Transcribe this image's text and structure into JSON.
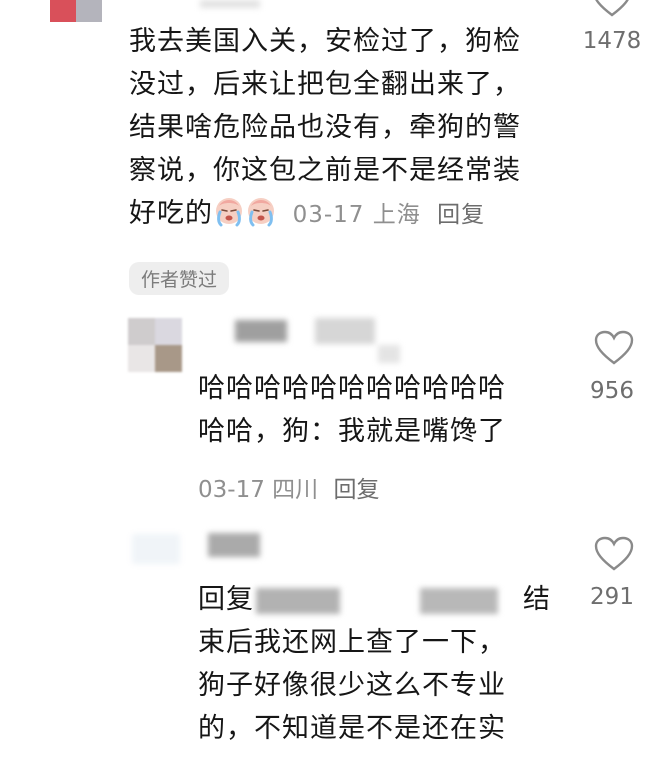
{
  "comments": [
    {
      "text_lines": [
        "我去美国入关，安检过了，狗检",
        "没过，后来让把包全翻出来了，",
        "结果啥危险品也没有，牵狗的警",
        "察说，你这包之前是不是经常装",
        "好吃的"
      ],
      "emoji": [
        "crying-face",
        "crying-face"
      ],
      "date": "03-17",
      "location": "上海",
      "reply_label": "回复",
      "like_count": "1478",
      "badge": "作者赞过"
    },
    {
      "text_lines": [
        "哈哈哈哈哈哈哈哈哈哈哈",
        "哈哈，狗：我就是嘴馋了"
      ],
      "date": "03-17",
      "location": "四川",
      "reply_label": "回复",
      "like_count": "956"
    },
    {
      "text_prefix": "回复",
      "text_suffix": "结",
      "text_lines": [
        "束后我还网上查了一下，",
        "狗子好像很少这么不专业",
        "的，不知道是不是还在实"
      ],
      "like_count": "291"
    }
  ],
  "icons": {
    "like": "heart-outline-icon"
  },
  "colors": {
    "text": "#161616",
    "meta": "#8f8f8f",
    "count": "#6e6e6e",
    "badge_bg": "#eeeeee"
  }
}
